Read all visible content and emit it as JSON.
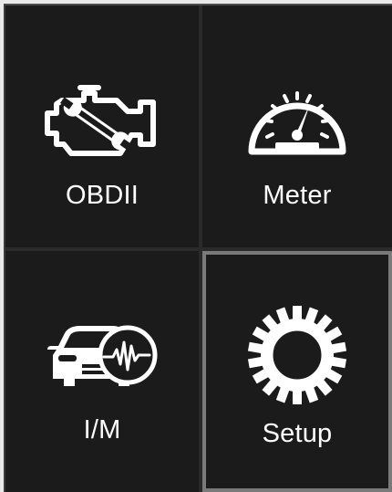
{
  "menu": {
    "tiles": [
      {
        "label": "OBDII",
        "icon": "engine-icon",
        "selected": false
      },
      {
        "label": "Meter",
        "icon": "speedometer-icon",
        "selected": false
      },
      {
        "label": "I/M",
        "icon": "car-diagnostic-icon",
        "selected": false
      },
      {
        "label": "Setup",
        "icon": "gear-icon",
        "selected": true
      }
    ]
  },
  "colors": {
    "background": "#1b1b1b",
    "icon": "#ffffff",
    "selection_border": "#7a7a7a"
  }
}
